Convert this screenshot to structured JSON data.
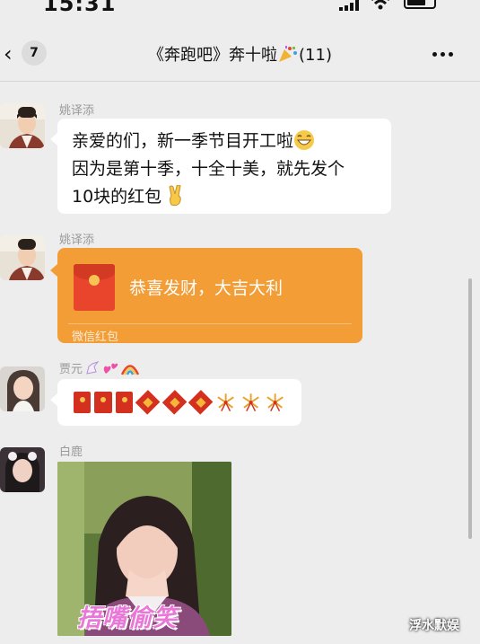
{
  "status_bar": {
    "time": "15:31"
  },
  "nav": {
    "back_icon": "chevron-left-icon",
    "unread_count": "7",
    "title": "《奔跑吧》奔十啦",
    "member_count": "(11)",
    "more_icon": "more-dots-icon"
  },
  "messages": [
    {
      "sender": "姚译添",
      "type": "text",
      "lines": [
        "亲爱的们，新一季节目开工啦",
        "因为是第十季，十全十美，就先发个",
        "10块的红包"
      ]
    },
    {
      "sender": "姚译添",
      "type": "red-packet",
      "greeting": "恭喜发财，大吉大利",
      "label": "微信红包"
    },
    {
      "sender": "贾元",
      "type": "emoji",
      "emoji_sequence": [
        "red-envelope-icon",
        "red-envelope-icon",
        "red-envelope-icon",
        "fu-diamond-icon",
        "fu-diamond-icon",
        "fu-diamond-icon",
        "firework-icon",
        "firework-icon",
        "firework-icon"
      ]
    },
    {
      "sender": "白鹿",
      "type": "sticker",
      "caption": "捂嘴偷笑"
    }
  ],
  "watermark": "浮水默娱",
  "colors": {
    "background": "#ededed",
    "bubble": "#ffffff",
    "red_packet": "#f39d37",
    "name_gray": "#9a9a9a"
  }
}
